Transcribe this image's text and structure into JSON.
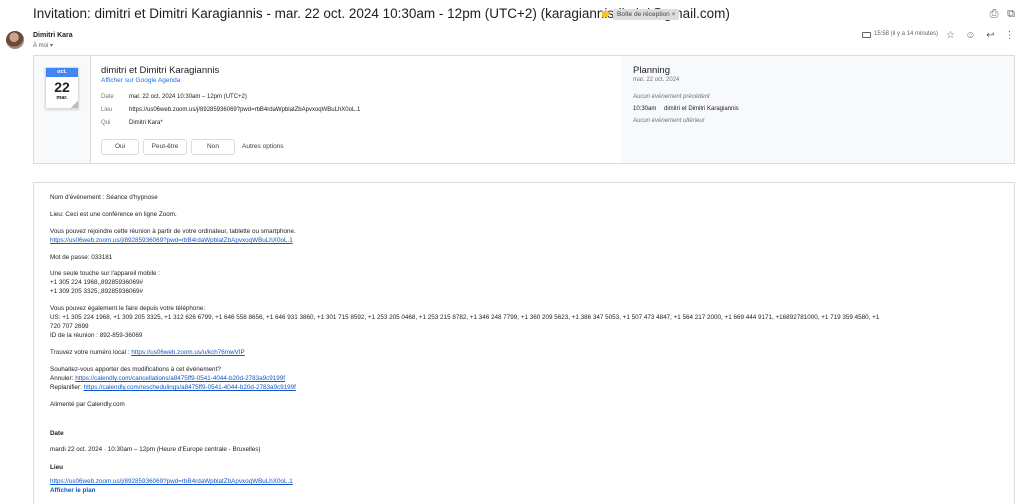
{
  "subject": "Invitation: dimitri et Dimitri Karagiannis - mar. 22 oct. 2024 10:30am - 12pm (UTC+2) (karagiannisdimitri@gmail.com)",
  "label_chip": "Boîte de réception ×",
  "sender": "Dimitri Kara",
  "to": "À moi ▾",
  "time": "15:58 (il y a 14 minutes)",
  "calendar": {
    "month": "oct.",
    "day": "22",
    "weekday": "mar."
  },
  "event": {
    "title": "dimitri et Dimitri Karagiannis",
    "agenda_link": "Afficher sur Google Agenda",
    "date_label": "Date",
    "date_value": "mar. 22 oct. 2024 10:30am – 12pm (UTC+2)",
    "place_label": "Lieu",
    "place_value": "https://us06web.zoom.us/j/89285936069?pwd=rbB4rdaWpblatZbApvxoqWBuLhX0oL.1",
    "who_label": "Qui",
    "who_value": "Dimitri Kara*"
  },
  "rsvp": {
    "yes": "Oui",
    "maybe": "Peut-être",
    "no": "Non",
    "more": "Autres options"
  },
  "planning": {
    "title": "Planning",
    "date": "mar. 22 oct. 2024",
    "prev": "Aucun événement précédent",
    "event_time": "10:30am",
    "event_name": "dimitri et Dimitri Karagiannis",
    "next": "Aucun événement ultérieur"
  },
  "body": {
    "l1": "Nom d'événement : Séance d'hypnose",
    "l2": "Lieu: Ceci est une conférence en ligne Zoom.",
    "l3": "Vous pouvez rejoindre cette réunion à partir de votre ordinateur, tablette ou smartphone.",
    "l4": "https://us06web.zoom.us/j/89285936069?pwd=rbB4rdaWpblatZbApvxoqWBuLhX0oL.1",
    "l5": "Mot de passe: 033181",
    "l6": "Une seule touche sur l'appareil mobile :",
    "l7": "+1 305 224 1968,,89285936069#",
    "l8": "+1 309 205 3325,,89285936069#",
    "l9": "Vous pouvez également le faire depuis votre téléphone:",
    "l10": "US: +1 305 224 1968, +1 309 205 3325, +1 312 626 6799, +1 646 558 8656, +1 646 931 3860, +1 301 715 8592, +1 253 205 0468, +1 253 215 8782, +1 346 248 7799, +1 360 209 5623, +1 386 347 5053, +1 507 473 4847, +1 564 217 2000, +1 669 444 9171, +16892781000, +1 719 359 4580, +1",
    "l11": "720 707 2699",
    "l12": "ID de la réunion : 892-859-36069",
    "l13_text": "Trouvez votre numéro local : ",
    "l13_link": "https://us06web.zoom.us/u/kch76mwVIP",
    "l14": "Souhaitez-vous apporter des modifications à cet événement?",
    "l15_text": "Annuler: ",
    "l15_link": "https://calendly.com/cancellations/a8475ff9-0541-4044-b20d-2783a9c9199f",
    "l16_text": "Replanifier: ",
    "l16_link": "https://calendly.com/reschedulings/a8475ff9-0541-4044-b20d-2783a9c9199f",
    "l17": "Alimenté par Calendly.com",
    "date_h": "Date",
    "date_v": "mardi 22 oct. 2024 · 10:30am – 12pm (Heure d'Europe centrale - Bruxelles)",
    "lieu_h": "Lieu",
    "lieu_link": "https://us06web.zoom.us/j/89285936069?pwd=rbB4rdaWpblatZbApvxoqWBuLhX0oL.1",
    "map_link": "Afficher le plan"
  },
  "colors": {
    "link": "#1155cc",
    "calendar_blue": "#4285f4",
    "accent": "#1a73e8"
  }
}
